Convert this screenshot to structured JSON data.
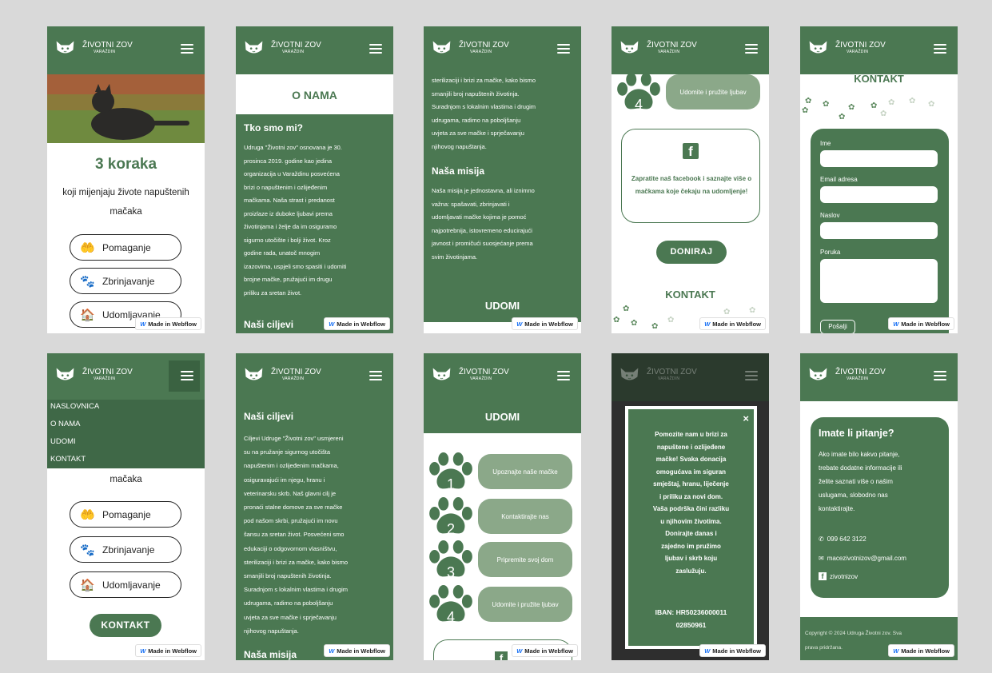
{
  "brand": {
    "name": "ŽIVOTNI ZOV",
    "city": "VARAŽDIN"
  },
  "badge": {
    "icon": "webflow-logo-icon",
    "label": "Made in Webflow"
  },
  "colors": {
    "brand_green": "#4b7852",
    "light_green": "#8ba889",
    "white": "#ffffff"
  },
  "home": {
    "heading": "3 koraka",
    "subtitle_line1": "koji mijenjaju živote napuštenih",
    "subtitle_line2": "mačaka",
    "buttons": [
      {
        "icon": "helping-hand-heart-icon",
        "label": "Pomaganje"
      },
      {
        "icon": "paw-icon",
        "label": "Zbrinjavanje"
      },
      {
        "icon": "house-icon",
        "label": "Udomljavanje"
      }
    ],
    "cta": "KONTAKT"
  },
  "menu": {
    "items": [
      "NASLOVNICA",
      "O NAMA",
      "UDOMI",
      "KONTAKT"
    ]
  },
  "about": {
    "title": "O NAMA",
    "who_heading": "Tko smo mi?",
    "who_lines": [
      "Udruga \"Životni zov\" osnovana je 30.",
      "prosinca 2019. godine kao jedina",
      "organizacija u Varaždinu posvećena",
      "brizi o napuštenim i ozlijeđenim",
      "mačkama. Naša strast i predanost",
      "proizlaze iz duboke ljubavi prema",
      "životinjama i želje da im osiguramo",
      "sigurno utočište i bolji život. Kroz",
      "godine rada, unatoč mnogim",
      "izazovima, uspjeli smo spasiti i udomiti",
      "brojne mačke, pružajući im drugu",
      "priliku za sretan život."
    ],
    "goals_heading": "Naši ciljevi",
    "goals_lines": [
      "Ciljevi Udruge \"Životni zov\" usmjereni",
      "su na pružanje sigurnog utočišta",
      "napuštenim i ozlijeđenim mačkama,",
      "osiguravajući im njegu, hranu i",
      "veterinarsku skrb. Naš glavni cilj je",
      "pronaći stalne domove za sve mačke",
      "pod našom skrbi, pružajući im novu",
      "šansu za sretan život. Posvećeni smo",
      "edukaciji o odgovornom vlasništvu,",
      "sterilizaciji i brizi za mačke, kako bismo",
      "smanjili broj napuštenih životinja.",
      "Suradnjom s lokalnim vlastima i drugim",
      "udrugama, radimo na poboljšanju",
      "uvjeta za sve mačke i sprječavanju",
      "njihovog napuštanja."
    ],
    "mission_heading": "Naša misija",
    "mission_lines": [
      "Naša misija je jednostavna, ali iznimno",
      "važna: spašavati, zbrinjavati i",
      "udomljavati mačke kojima je pomoć",
      "najpotrebnija, istovremeno educirajući",
      "javnost i promičući suosjećanje prema",
      "svim životinjama."
    ]
  },
  "adopt": {
    "title": "UDOMI",
    "steps": [
      {
        "num": "1",
        "label": "Upoznajte naše mačke"
      },
      {
        "num": "2",
        "label": "Kontaktirajte nas"
      },
      {
        "num": "3",
        "label": "Pripremite svoj dom"
      },
      {
        "num": "4",
        "label": "Udomite i pružite ljubav"
      }
    ],
    "facebook_text": "Zapratite naš facebook i saznajte više o mačkama koje čekaju na udomljenje!",
    "donate": "DONIRAJ",
    "contact_title": "KONTAKT"
  },
  "donation": {
    "close": "×",
    "text_lines": [
      "Pomozite nam u brizi za",
      "napuštene i ozlijeđene",
      "mačke! Svaka donacija",
      "omogućava im siguran",
      "smještaj, hranu, liječenje",
      "i priliku za novi dom.",
      "Vaša podrška čini razliku",
      "u njihovim životima.",
      "Donirajte danas i",
      "zajedno im pružimo",
      "ljubav i skrb koju",
      "zaslužuju."
    ],
    "iban_line1": "IBAN: HR50236000011",
    "iban_line2": "02850961"
  },
  "contact_form": {
    "title": "KONTAKT",
    "fields": [
      "Ime",
      "Email adresa",
      "Naslov",
      "Poruka"
    ],
    "submit": "Pošalji"
  },
  "question": {
    "heading": "Imate li pitanje?",
    "lines": [
      "Ako imate bilo kakvo pitanje,",
      "trebate dodatne informacije ili",
      "želite saznati više o našim",
      "uslugama, slobodno nas",
      "kontaktirajte."
    ],
    "phone": "099 642 3122",
    "email": "macezivotnizov@gmail.com",
    "facebook": "zivotnizov",
    "copyright_line1": "Copyright © 2024 Udruga Životni zov. Sva",
    "copyright_line2": "prava pridržana."
  }
}
